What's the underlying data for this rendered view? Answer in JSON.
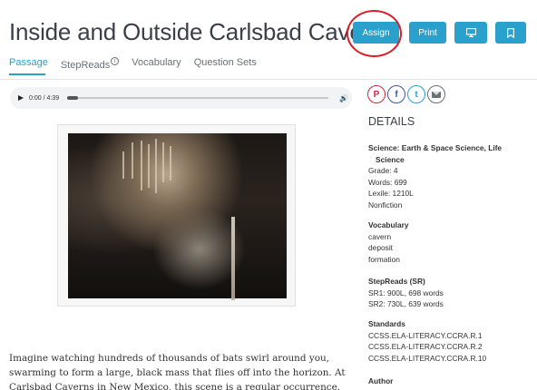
{
  "header": {
    "title": "Inside and Outside Carlsbad Caverns",
    "assign_label": "Assign",
    "print_label": "Print",
    "icon1": "monitor-icon",
    "icon2": "bookmark-icon"
  },
  "tabs": [
    {
      "label": "Passage",
      "active": true
    },
    {
      "label": "StepReads",
      "badge": "i"
    },
    {
      "label": "Vocabulary"
    },
    {
      "label": "Question Sets"
    }
  ],
  "audio": {
    "time": "0:00 / 4:39",
    "progress": 0.0
  },
  "image": {
    "alt": "cave photo"
  },
  "passage": {
    "l1": "Imagine watching hundreds of thousands of bats swirl around you,",
    "l2": "swarming to form a large, black mass that flies off into the horizon. At",
    "l3": "Carlsbad Caverns in New Mexico, this scene is a regular occurrence. The"
  },
  "share": {
    "pinterest": "P",
    "facebook": "f",
    "twitter": "t",
    "email": "email-icon"
  },
  "details": {
    "heading": "DETAILS",
    "subject_l1": "Science: Earth & Space Science, Life",
    "subject_l2": "Science",
    "grade": "Grade: 4",
    "words": "Words: 699",
    "lexile": "Lexile: 1210L",
    "genre": "Nonfiction",
    "vocab_h": "Vocabulary",
    "vocab": [
      "cavern",
      "deposit",
      "formation"
    ],
    "stepreads_h": "StepReads (SR)",
    "sr1": "SR1: 900L, 698 words",
    "sr2": "SR2: 730L, 639 words",
    "standards_h": "Standards",
    "standards": [
      "CCSS.ELA-LITERACY.CCRA.R.1",
      "CCSS.ELA-LITERACY.CCRA.R.2",
      "CCSS.ELA-LITERACY.CCRA.R.10"
    ],
    "author_h": "Author"
  },
  "colors": {
    "accent": "#2aa0cc",
    "annotation": "#d8202a"
  }
}
